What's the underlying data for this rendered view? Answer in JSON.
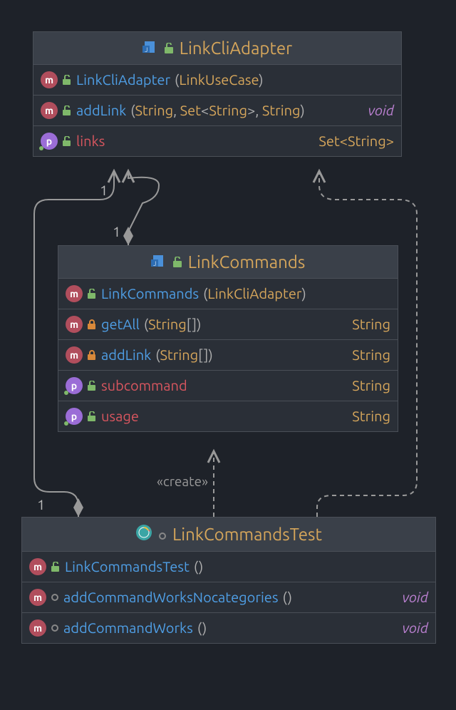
{
  "classes": {
    "linkCliAdapter": {
      "title": "LinkCliAdapter",
      "rows": [
        {
          "kind": "m",
          "vis": "unlock",
          "name": "LinkCliAdapter",
          "params": "(LinkUseCase)",
          "ret": "",
          "retClass": ""
        },
        {
          "kind": "m",
          "vis": "unlock",
          "name": "addLink",
          "params": "(String, Set<String>, String)",
          "ret": "void",
          "retClass": "ret-void"
        },
        {
          "kind": "p",
          "vis": "unlock",
          "name": "links",
          "params": "",
          "ret": "Set<String>",
          "retClass": ""
        }
      ]
    },
    "linkCommands": {
      "title": "LinkCommands",
      "rows": [
        {
          "kind": "m",
          "vis": "unlock",
          "name": "LinkCommands",
          "params": "(LinkCliAdapter)",
          "ret": "",
          "retClass": ""
        },
        {
          "kind": "m",
          "vis": "lock",
          "name": "getAll",
          "params": "(String[])",
          "ret": "String",
          "retClass": ""
        },
        {
          "kind": "m",
          "vis": "lock",
          "name": "addLink",
          "params": "(String[])",
          "ret": "String",
          "retClass": ""
        },
        {
          "kind": "p",
          "vis": "unlock",
          "name": "subcommand",
          "params": "",
          "ret": "String",
          "retClass": ""
        },
        {
          "kind": "p",
          "vis": "unlock",
          "name": "usage",
          "params": "",
          "ret": "String",
          "retClass": ""
        }
      ]
    },
    "linkCommandsTest": {
      "title": "LinkCommandsTest",
      "rows": [
        {
          "kind": "m",
          "vis": "unlock",
          "name": "LinkCommandsTest",
          "params": "()",
          "ret": "",
          "retClass": ""
        },
        {
          "kind": "m",
          "vis": "hollow",
          "name": "addCommandWorksNocategories",
          "params": "()",
          "ret": "void",
          "retClass": "ret-void"
        },
        {
          "kind": "m",
          "vis": "hollow",
          "name": "addCommandWorks",
          "params": "()",
          "ret": "void",
          "retClass": "ret-void"
        }
      ]
    }
  },
  "labels": {
    "create": "«create»",
    "one_a": "1",
    "one_b": "1",
    "one_c": "1"
  }
}
